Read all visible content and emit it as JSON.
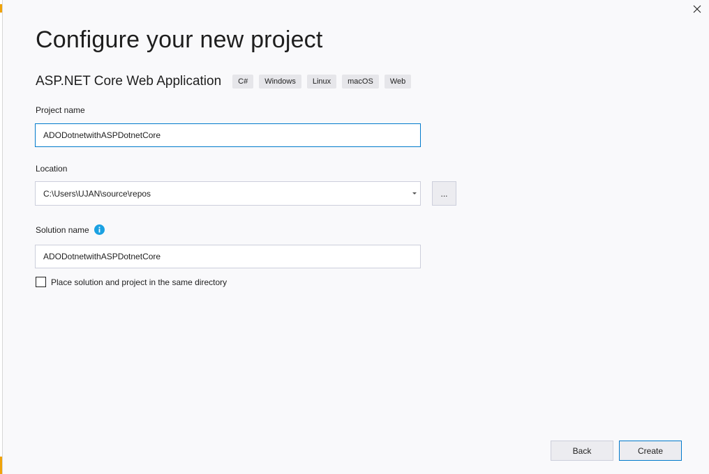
{
  "window": {
    "close_label": "Close"
  },
  "header": {
    "title": "Configure your new project",
    "template_name": "ASP.NET Core Web Application",
    "tags": [
      "C#",
      "Windows",
      "Linux",
      "macOS",
      "Web"
    ]
  },
  "form": {
    "project_name": {
      "label": "Project name",
      "value": "ADODotnetwithASPDotnetCore"
    },
    "location": {
      "label": "Location",
      "value": "C:\\Users\\UJAN\\source\\repos",
      "browse_label": "..."
    },
    "solution_name": {
      "label": "Solution name",
      "value": "ADODotnetwithASPDotnetCore",
      "info_icon": "info-icon"
    },
    "same_directory": {
      "label": "Place solution and project in the same directory",
      "checked": false
    }
  },
  "footer": {
    "back_label": "Back",
    "create_label": "Create"
  },
  "colors": {
    "accent": "#007acc",
    "info": "#1ba1e2",
    "edge_accent": "#f0a30a"
  }
}
